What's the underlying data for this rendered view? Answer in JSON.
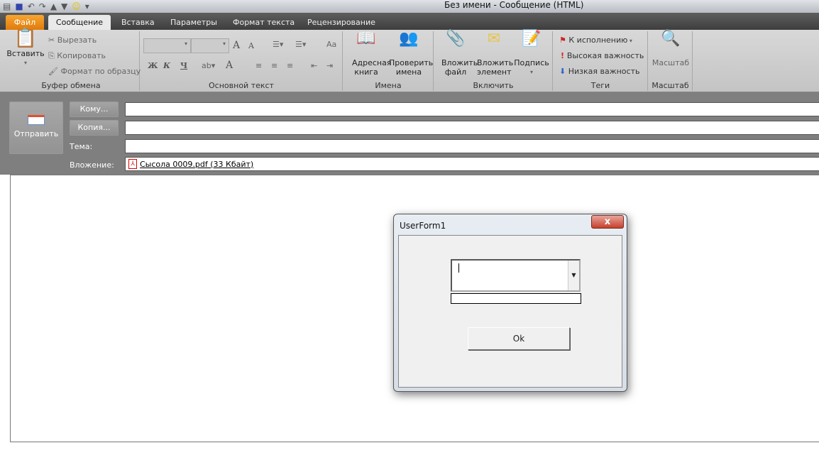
{
  "window": {
    "title": "Без имени  -  Сообщение (HTML)"
  },
  "tabs": [
    {
      "label": "Файл"
    },
    {
      "label": "Сообщение"
    },
    {
      "label": "Вставка"
    },
    {
      "label": "Параметры"
    },
    {
      "label": "Формат текста"
    },
    {
      "label": "Рецензирование"
    }
  ],
  "ribbon": {
    "clipboard": {
      "label": "Буфер обмена",
      "paste": "Вставить",
      "cut": "Вырезать",
      "copy": "Копировать",
      "format_painter": "Формат по образцу"
    },
    "basic_text": {
      "label": "Основной текст",
      "bold": "Ж",
      "italic": "К",
      "underline": "Ч",
      "grow": "A",
      "shrink": "A",
      "font_color": "A"
    },
    "names": {
      "label": "Имена",
      "address_book": "Адресная книга",
      "check_names": "Проверить имена"
    },
    "include": {
      "label": "Включить",
      "attach_file": "Вложить файл",
      "attach_item": "Вложить элемент",
      "signature": "Подпись"
    },
    "tags": {
      "label": "Теги",
      "follow_up": "К исполнению",
      "high": "Высокая важность",
      "low": "Низкая важность"
    },
    "zoom": {
      "label": "Масштаб",
      "button": "Масштаб"
    }
  },
  "header": {
    "send": "Отправить",
    "to": "Кому...",
    "cc": "Копия...",
    "subject_label": "Тема:",
    "attachment_label": "Вложение:",
    "attachment": "Сысола 0009.pdf (33 Кбайт)",
    "to_value": "",
    "cc_value": "",
    "subject_value": ""
  },
  "dialog": {
    "title": "UserForm1",
    "close": "x",
    "combo_value": "",
    "text_value": "",
    "ok": "Ok"
  }
}
